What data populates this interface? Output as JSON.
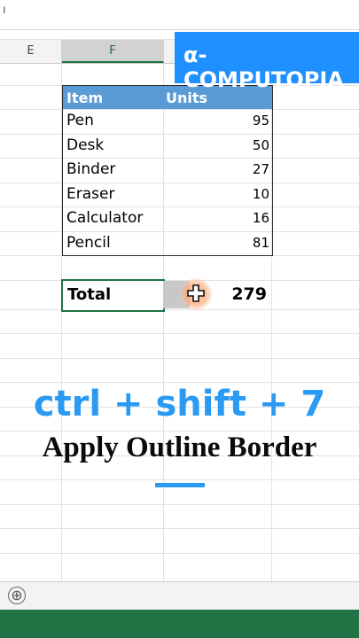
{
  "formula_bar": {
    "fx_label": "ı"
  },
  "columns": {
    "e": "E",
    "f": "F"
  },
  "brand": {
    "name": "α-COMPUTOPIA",
    "color": "#1e90ff"
  },
  "table": {
    "header_item": "Item",
    "header_units": "Units",
    "header_color": "#5b9bd5",
    "rows": [
      {
        "item": "Pen",
        "units": "95"
      },
      {
        "item": "Desk",
        "units": "50"
      },
      {
        "item": "Binder",
        "units": "27"
      },
      {
        "item": "Eraser",
        "units": "10"
      },
      {
        "item": "Calculator",
        "units": "16"
      },
      {
        "item": "Pencil",
        "units": "81"
      }
    ]
  },
  "total": {
    "label": "Total",
    "value": "279"
  },
  "overlay": {
    "shortcut": "ctrl + shift + 7",
    "title": "Apply Outline Border",
    "accent_color": "#2b9af3"
  },
  "sheet_tabs": {
    "add_icon": "⊕"
  },
  "status_bar_color": "#217346"
}
